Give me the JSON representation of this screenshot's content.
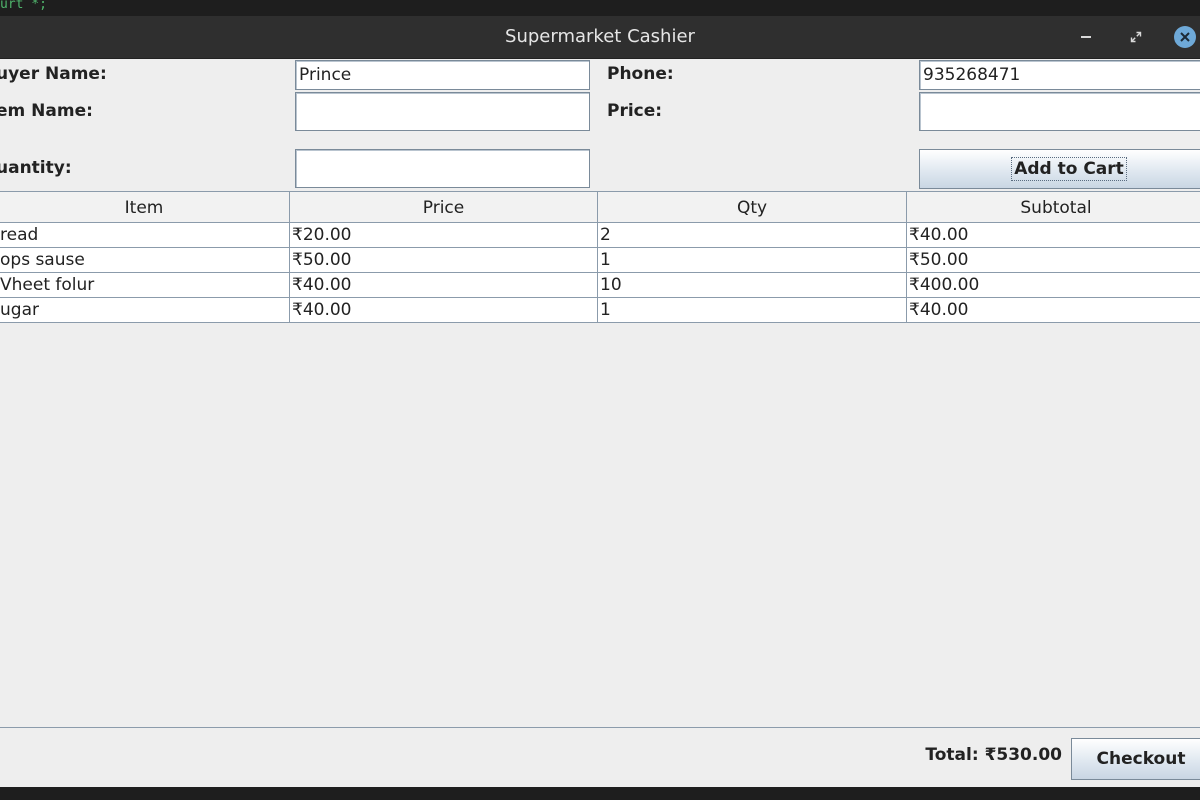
{
  "background_terminal": {
    "text": "urt *;"
  },
  "window": {
    "title": "Supermarket Cashier",
    "controls": {
      "minimize": "minimize-icon",
      "maximize": "restore-icon",
      "close": "close-icon"
    }
  },
  "form": {
    "buyer_name_label": "uyer Name:",
    "buyer_name_value": "Prince",
    "phone_label": "Phone:",
    "phone_value": "935268471",
    "item_name_label": "em Name:",
    "item_name_value": "",
    "price_label": "Price:",
    "price_value": "",
    "quantity_label": "uantity:",
    "quantity_value": "",
    "add_to_cart_label": "Add to Cart"
  },
  "table": {
    "headers": [
      "Item",
      "Price",
      "Qty",
      "Subtotal"
    ],
    "rows": [
      [
        "read",
        "₹20.00",
        "2",
        "₹40.00"
      ],
      [
        "ops sause",
        "₹50.00",
        "1",
        "₹50.00"
      ],
      [
        "Vheet folur",
        "₹40.00",
        "10",
        "₹400.00"
      ],
      [
        "ugar",
        "₹40.00",
        "1",
        "₹40.00"
      ]
    ]
  },
  "footer": {
    "total_label": "Total: ₹530.00",
    "checkout_label": "Checkout"
  },
  "colors": {
    "title_bar": "#2f2f2f",
    "window_bg": "#eeeeee",
    "close_button": "#6ea9d8",
    "grid_line": "#8b9bab"
  }
}
